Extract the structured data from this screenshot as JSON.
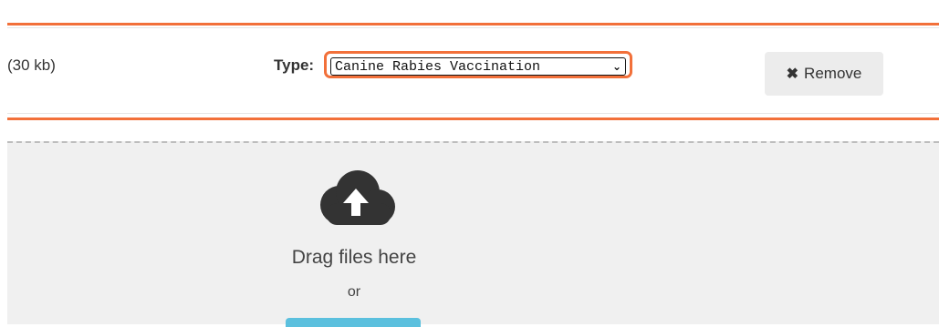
{
  "file_row": {
    "size_text": "(30 kb)",
    "type_label": "Type:",
    "type_select_value": "Canine Rabies Vaccination",
    "remove_label": "Remove"
  },
  "dropzone": {
    "icon": "cloud-upload-icon",
    "drag_text": "Drag files here",
    "or_text": "or"
  },
  "colors": {
    "accent": "#f2703a",
    "dropzone_bg": "#f0f0f0",
    "browse_button": "#5bc0de"
  }
}
